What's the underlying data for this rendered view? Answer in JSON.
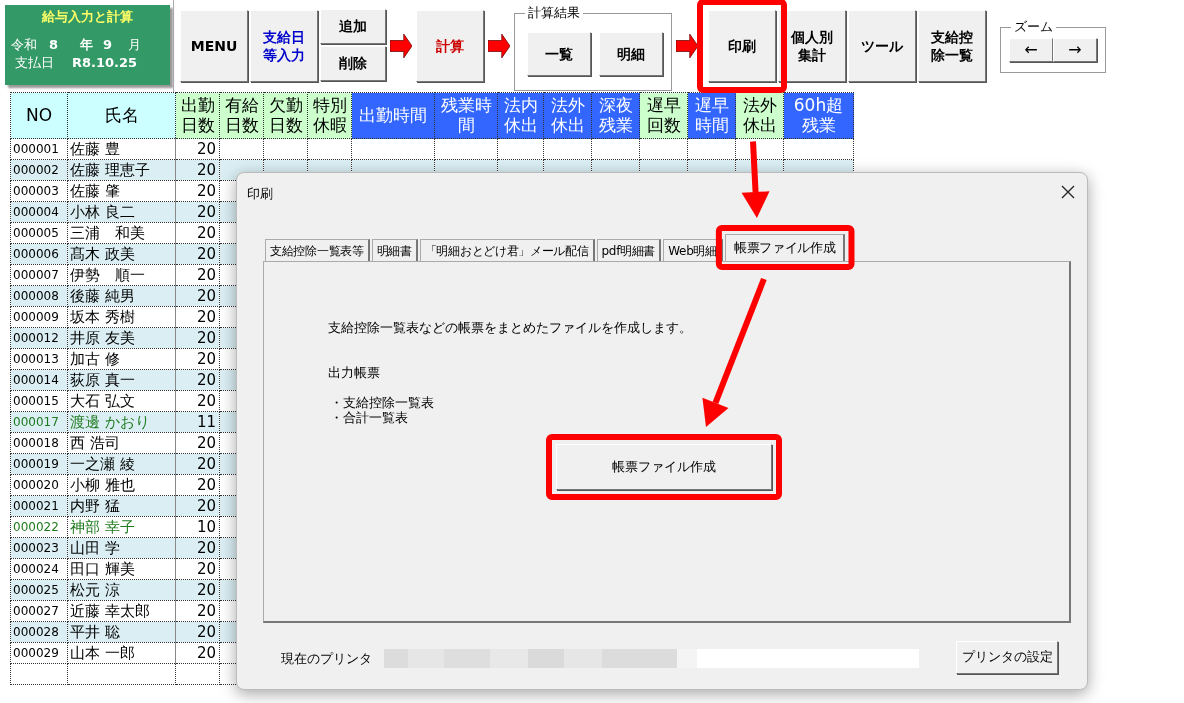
{
  "app_panel": {
    "title": "給与入力と計算",
    "era": "令和",
    "year": "8",
    "year_label": "年",
    "month": "9",
    "month_label": "月",
    "payday_label": "支払日",
    "payday": "R8.10.25"
  },
  "toolbar": [
    {
      "kind": "button",
      "label": "MENU",
      "color": "#000000"
    },
    {
      "kind": "button",
      "label": "支給日等入力",
      "color": "#0000cc"
    },
    {
      "kind": "stack",
      "buttons": [
        "追加",
        "削除"
      ]
    },
    {
      "kind": "arrow"
    },
    {
      "kind": "button",
      "label": "計算",
      "color": "#cc0000"
    },
    {
      "kind": "arrow"
    },
    {
      "kind": "group",
      "title": "計算結果",
      "buttons": [
        "一覧",
        "明細"
      ]
    },
    {
      "kind": "arrow"
    },
    {
      "kind": "button",
      "label": "印刷",
      "color": "#000000"
    },
    {
      "kind": "button",
      "label": "個人別集計",
      "color": "#000000"
    },
    {
      "kind": "button",
      "label": "ツール",
      "color": "#000000"
    },
    {
      "kind": "button",
      "label": "支給控除一覧",
      "color": "#000000"
    },
    {
      "kind": "zoom",
      "title": "ズーム",
      "buttons": [
        "←",
        "→"
      ]
    }
  ],
  "table": {
    "columns": [
      {
        "label": "NO",
        "color": "#ccffff"
      },
      {
        "label": "氏名",
        "color": "#ccffff"
      },
      {
        "label": "出勤日数",
        "color": "#ccffcc"
      },
      {
        "label": "有給日数",
        "color": "#ccffcc"
      },
      {
        "label": "欠勤日数",
        "color": "#ccffcc"
      },
      {
        "label": "特別休暇",
        "color": "#ccffcc"
      },
      {
        "label": "出勤時間",
        "color": "#3366ff"
      },
      {
        "label": "残業時間",
        "color": "#3366ff"
      },
      {
        "label": "法内休出",
        "color": "#3366ff"
      },
      {
        "label": "法外休出",
        "color": "#3366ff"
      },
      {
        "label": "深夜残業",
        "color": "#3366ff"
      },
      {
        "label": "遅早回数",
        "color": "#ccffcc"
      },
      {
        "label": "遅早時間",
        "color": "#3366ff"
      },
      {
        "label": "法外休出",
        "color": "#ccffcc"
      },
      {
        "label": "60h超残業",
        "color": "#3366ff"
      }
    ],
    "rows": [
      {
        "no": "000001",
        "name": "佐藤 豊",
        "days": "20",
        "color": "#000000"
      },
      {
        "no": "000002",
        "name": "佐藤 理恵子",
        "days": "20",
        "color": "#000000"
      },
      {
        "no": "000003",
        "name": "佐藤 肇",
        "days": "20",
        "color": "#000000"
      },
      {
        "no": "000004",
        "name": "小林 良二",
        "days": "20",
        "color": "#000000"
      },
      {
        "no": "000005",
        "name": "三浦　和美",
        "days": "20",
        "color": "#000000"
      },
      {
        "no": "000006",
        "name": "髙木 政美",
        "days": "20",
        "color": "#000000"
      },
      {
        "no": "000007",
        "name": "伊勢　順一",
        "days": "20",
        "color": "#000000"
      },
      {
        "no": "000008",
        "name": "後藤 純男",
        "days": "20",
        "color": "#000000"
      },
      {
        "no": "000009",
        "name": "坂本 秀樹",
        "days": "20",
        "color": "#000000"
      },
      {
        "no": "000012",
        "name": "井原 友美",
        "days": "20",
        "color": "#000000"
      },
      {
        "no": "000013",
        "name": "加古 修",
        "days": "20",
        "color": "#000000"
      },
      {
        "no": "000014",
        "name": "荻原 真一",
        "days": "20",
        "color": "#000000"
      },
      {
        "no": "000015",
        "name": "大石 弘文",
        "days": "20",
        "color": "#000000"
      },
      {
        "no": "000017",
        "name": "渡邊 かおり",
        "days": "11",
        "color": "#1e7b1e"
      },
      {
        "no": "000018",
        "name": "西 浩司",
        "days": "20",
        "color": "#000000"
      },
      {
        "no": "000019",
        "name": "一之瀬 綾",
        "days": "20",
        "color": "#000000"
      },
      {
        "no": "000020",
        "name": "小柳 雅也",
        "days": "20",
        "color": "#000000"
      },
      {
        "no": "000021",
        "name": "内野 猛",
        "days": "20",
        "color": "#000000"
      },
      {
        "no": "000022",
        "name": "神部 幸子",
        "days": "10",
        "color": "#1e7b1e"
      },
      {
        "no": "000023",
        "name": "山田 学",
        "days": "20",
        "color": "#000000"
      },
      {
        "no": "000024",
        "name": "田口 輝美",
        "days": "20",
        "color": "#000000"
      },
      {
        "no": "000025",
        "name": "松元 涼",
        "days": "20",
        "color": "#000000"
      },
      {
        "no": "000027",
        "name": "近藤 幸太郎",
        "days": "20",
        "color": "#000000"
      },
      {
        "no": "000028",
        "name": "平井 聡",
        "days": "20",
        "color": "#000000"
      },
      {
        "no": "000029",
        "name": "山本 一郎",
        "days": "20",
        "color": "#000000"
      }
    ]
  },
  "dialog": {
    "title": "印刷",
    "tabs": [
      {
        "label": "支給控除一覧表等",
        "selected": false
      },
      {
        "label": "明細書",
        "selected": false
      },
      {
        "label": "「明細おとどけ君」メール配信",
        "selected": false
      },
      {
        "label": "pdf明細書",
        "selected": false
      },
      {
        "label": "Web明細",
        "selected": false
      },
      {
        "label": "帳票ファイル作成",
        "selected": true
      }
    ],
    "description": "支給控除一覧表などの帳票をまとめたファイルを作成します。",
    "output_heading": "出力帳票",
    "output_items": [
      "・支給控除一覧表",
      "・合計一覧表"
    ],
    "action_button": "帳票ファイル作成",
    "printer_label": "現在のプリンタ",
    "printer_button": "プリンタの設定"
  }
}
